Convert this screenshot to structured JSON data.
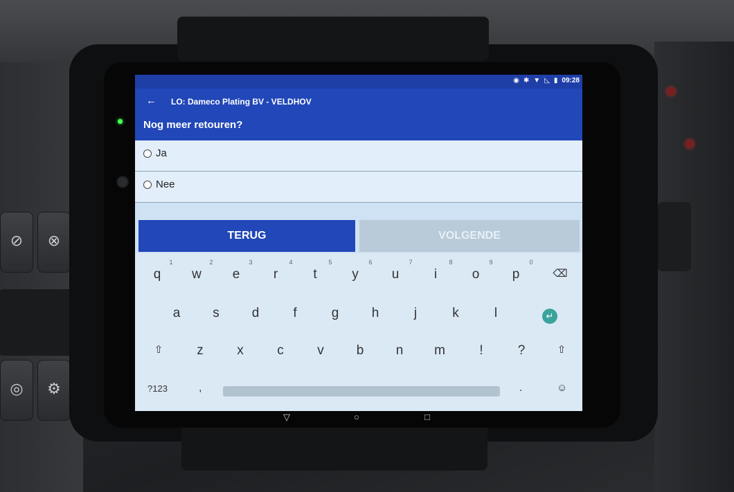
{
  "status_bar": {
    "icons": [
      "location-icon",
      "bluetooth-icon",
      "wifi-icon",
      "signal-icon",
      "battery-icon"
    ],
    "time": "09:28"
  },
  "app_bar": {
    "title": "LO: Dameco Plating BV - VELDHOV",
    "subtitle": "Nog meer retouren?"
  },
  "options": [
    {
      "label": "Ja"
    },
    {
      "label": "Nee"
    }
  ],
  "buttons": {
    "back_label": "TERUG",
    "next_label": "VOLGENDE"
  },
  "keyboard": {
    "row1": [
      "q",
      "w",
      "e",
      "r",
      "t",
      "y",
      "u",
      "i",
      "o",
      "p"
    ],
    "row1_hints": [
      "1",
      "2",
      "3",
      "4",
      "5",
      "6",
      "7",
      "8",
      "9",
      "0"
    ],
    "row2": [
      "a",
      "s",
      "d",
      "f",
      "g",
      "h",
      "j",
      "k",
      "l"
    ],
    "row3": [
      "z",
      "x",
      "c",
      "v",
      "b",
      "n",
      "m",
      "!",
      "?"
    ],
    "symbols_label": "?123",
    "comma": ",",
    "period": "."
  },
  "colors": {
    "app_bar": "#2147b8",
    "back_button": "#2147b8",
    "next_button_disabled": "#b9cbd9",
    "enter_key": "#3aa39b"
  }
}
